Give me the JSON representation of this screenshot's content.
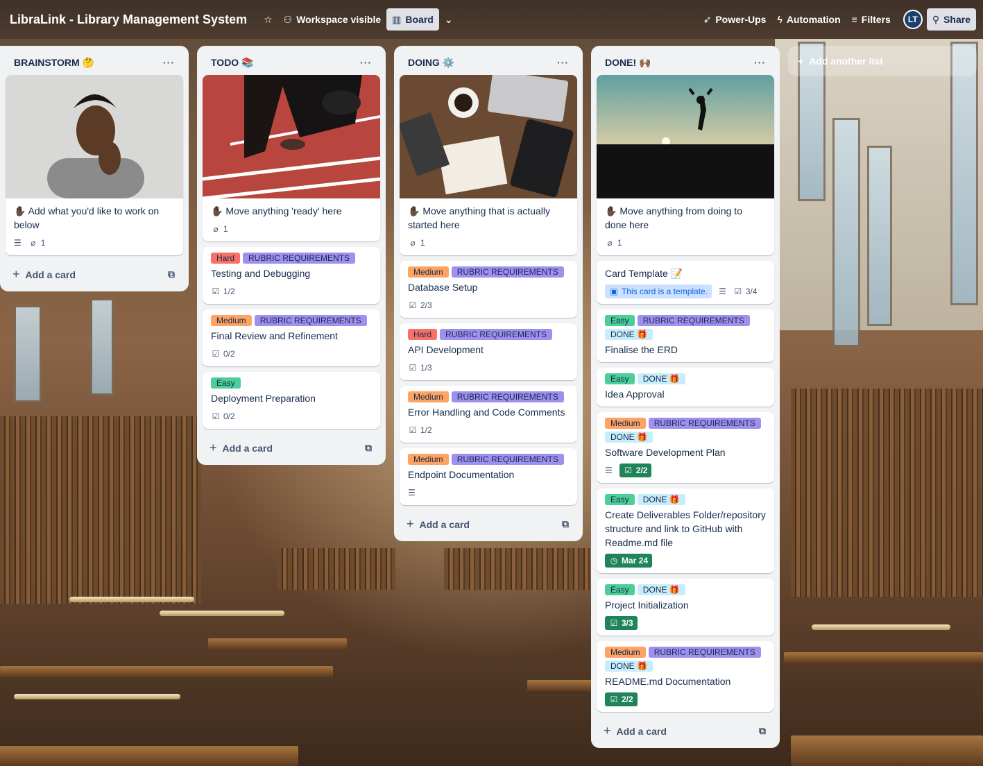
{
  "board": {
    "title": "LibraLink - Library Management System",
    "visibility": "Workspace visible",
    "view": "Board",
    "powerups": "Power-Ups",
    "automation": "Automation",
    "filters": "Filters",
    "avatar_initials": "LT",
    "share": "Share",
    "add_list": "Add another list"
  },
  "add_card_label": "Add a card",
  "lists": [
    {
      "title": "BRAINSTORM 🤔",
      "cards": [
        {
          "title": "✋🏿 Add what you'd like to work on below",
          "description": true,
          "attachments": "1",
          "cover": "person-thinking"
        }
      ]
    },
    {
      "title": "TODO 📚",
      "cards": [
        {
          "title": "✋🏿 Move anything 'ready' here",
          "attachments": "1",
          "cover": "runner"
        },
        {
          "labels": [
            "Hard",
            "RUBRIC REQUIREMENTS"
          ],
          "title": "Testing and Debugging",
          "checklist": "1/2"
        },
        {
          "labels": [
            "Medium",
            "RUBRIC REQUIREMENTS"
          ],
          "title": "Final Review and Refinement",
          "checklist": "0/2"
        },
        {
          "labels": [
            "Easy"
          ],
          "title": "Deployment Preparation",
          "checklist": "0/2"
        }
      ]
    },
    {
      "title": "DOING ⚙️",
      "cards": [
        {
          "title": "✋🏿 Move anything that is actually started here",
          "attachments": "1",
          "cover": "desk"
        },
        {
          "labels": [
            "Medium",
            "RUBRIC REQUIREMENTS"
          ],
          "title": "Database Setup",
          "checklist": "2/3"
        },
        {
          "labels": [
            "Hard",
            "RUBRIC REQUIREMENTS"
          ],
          "title": "API Development",
          "checklist": "1/3"
        },
        {
          "labels": [
            "Medium",
            "RUBRIC REQUIREMENTS"
          ],
          "title": "Error Handling and Code Comments",
          "checklist": "1/2"
        },
        {
          "labels": [
            "Medium",
            "RUBRIC REQUIREMENTS"
          ],
          "title": "Endpoint Documentation",
          "description": true
        }
      ]
    },
    {
      "title": "DONE! 🙌🏾",
      "cards": [
        {
          "title": "✋🏿 Move anything from doing to done here",
          "attachments": "1",
          "cover": "jump"
        },
        {
          "title": "Card Template 📝",
          "template": "This card is a template.",
          "description": true,
          "checklist": "3/4"
        },
        {
          "labels": [
            "Easy",
            "RUBRIC REQUIREMENTS",
            "DONE 🎁"
          ],
          "title": "Finalise the ERD"
        },
        {
          "labels": [
            "Easy",
            "DONE 🎁"
          ],
          "title": "Idea Approval"
        },
        {
          "labels": [
            "Medium",
            "RUBRIC REQUIREMENTS",
            "DONE 🎁"
          ],
          "title": "Software Development Plan",
          "description": true,
          "checklist_done": "2/2"
        },
        {
          "labels": [
            "Easy",
            "DONE 🎁"
          ],
          "title": "Create Deliverables Folder/repository structure and link to GitHub with Readme.md file",
          "due": "Mar 24"
        },
        {
          "labels": [
            "Easy",
            "DONE 🎁"
          ],
          "title": "Project Initialization",
          "checklist_done": "3/3"
        },
        {
          "labels": [
            "Medium",
            "RUBRIC REQUIREMENTS",
            "DONE 🎁"
          ],
          "title": "README.md Documentation",
          "checklist_done": "2/2"
        }
      ]
    }
  ],
  "label_colors": {
    "Hard": "#f87168",
    "Medium": "#fea362",
    "Easy": "#4bce97",
    "RUBRIC REQUIREMENTS": "#9f8fef",
    "DONE 🎁": "#c6edfb"
  }
}
